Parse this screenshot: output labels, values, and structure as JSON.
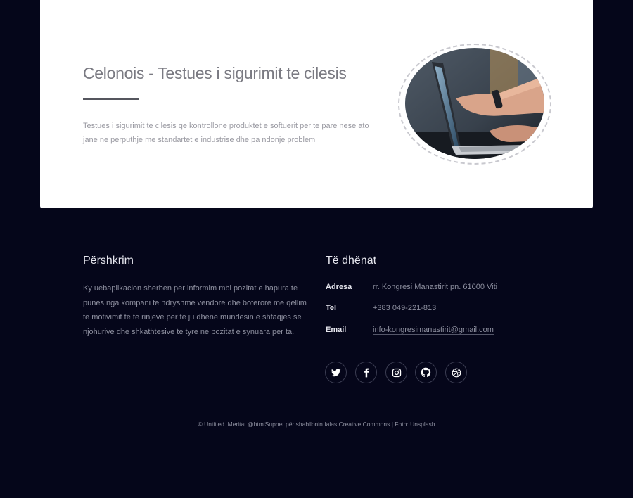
{
  "feature": {
    "title": "Celonois - Testues i sigurimit te cilesis",
    "description": "Testues i sigurimit te cilesis qe kontrollone produktet e softuerit per te pare nese ato jane ne perputhje me standartet e industrise dhe pa ndonje problem"
  },
  "footer": {
    "description_heading": "Përshkrim",
    "description_text": "Ky uebaplikacion sherben per informim mbi pozitat e hapura te punes nga kompani te ndryshme vendore dhe boterore me qellim te motivimit te te rinjeve per te ju dhene mundesin e shfaqjes se njohurive dhe shkathtesive te tyre ne pozitat e synuara per ta.",
    "info_heading": "Të dhënat",
    "address_label": "Adresa",
    "address_value": "rr. Kongresi Manastirit pn. 61000 Viti",
    "phone_label": "Tel",
    "phone_value": "+383 049-221-813",
    "email_label": "Email",
    "email_value": "info-kongresimanastirit@gmail.com",
    "social_icons": [
      "twitter-icon",
      "facebook-icon",
      "instagram-icon",
      "github-icon",
      "dribbble-icon"
    ],
    "copyright_prefix": "© Untitled. Meritat @htmlSupnet për shabllonin falas",
    "copyright_link1": "Creative Commons",
    "copyright_sep": "| Foto:",
    "copyright_link2": "Unsplash"
  },
  "colors": {
    "background": "#05061a",
    "card": "#ffffff",
    "heading_light": "#e6e6ee",
    "text_muted": "#8d8f9f"
  }
}
